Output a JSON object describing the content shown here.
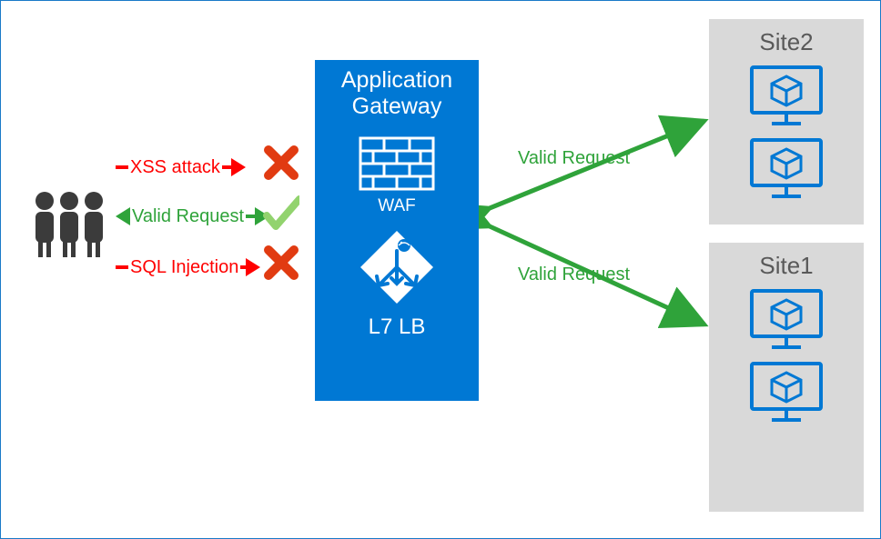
{
  "attacks": {
    "xss": "XSS attack",
    "sqli": "SQL Injection",
    "valid_in": "Valid Request"
  },
  "gateway": {
    "title_line1": "Application",
    "title_line2": "Gateway",
    "waf_label": "WAF",
    "lb_label": "L7 LB"
  },
  "forward": {
    "valid_top": "Valid Request",
    "valid_bottom": "Valid Request"
  },
  "sites": {
    "site2_title": "Site2",
    "site1_title": "Site1"
  },
  "colors": {
    "azure_blue": "#0078d4",
    "green": "#2fa33a",
    "red": "#ff0000",
    "block_red": "#e13b11",
    "allow_green": "#92d36e",
    "site_gray": "#d9d9d9",
    "title_gray": "#595959",
    "user_gray": "#3b3b3b"
  }
}
